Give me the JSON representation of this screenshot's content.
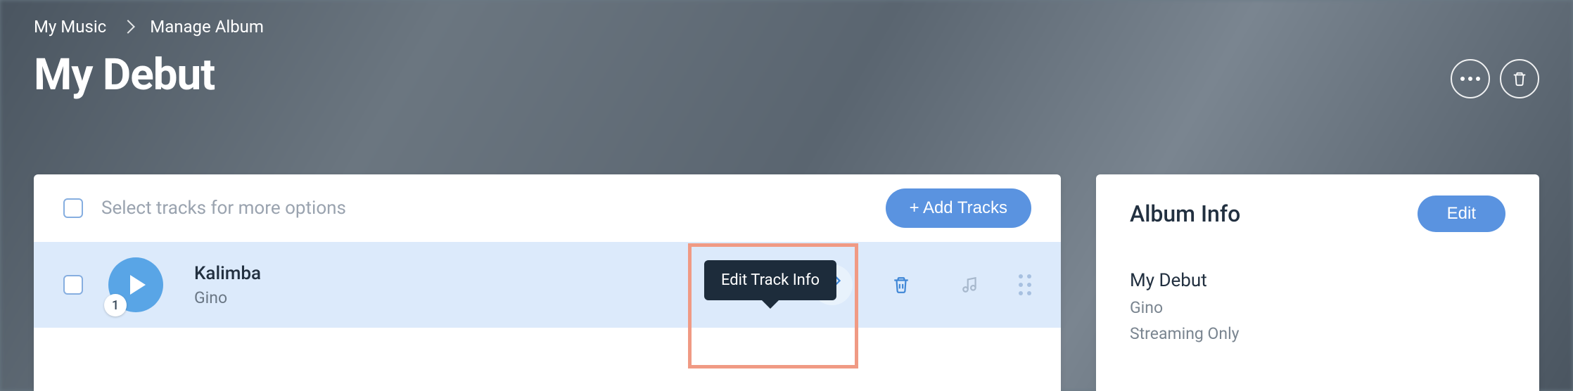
{
  "breadcrumb": {
    "root": "My Music",
    "current": "Manage Album"
  },
  "page_title": "My Debut",
  "header_actions": {
    "more_icon": "more-horizontal-icon",
    "delete_icon": "trash-icon"
  },
  "tracks_panel": {
    "select_hint": "Select tracks for more options",
    "add_button_label": "+ Add Tracks",
    "tooltip_text": "Edit Track Info",
    "tracks": [
      {
        "number": "1",
        "title": "Kalimba",
        "artist": "Gino"
      }
    ]
  },
  "info_panel": {
    "heading": "Album Info",
    "edit_label": "Edit",
    "album_name": "My Debut",
    "album_artist": "Gino",
    "album_license": "Streaming Only"
  },
  "colors": {
    "accent": "#5a93e0",
    "row_bg": "#dceafb",
    "tooltip_bg": "#1d2c3b",
    "highlight_border": "#f09a84"
  }
}
